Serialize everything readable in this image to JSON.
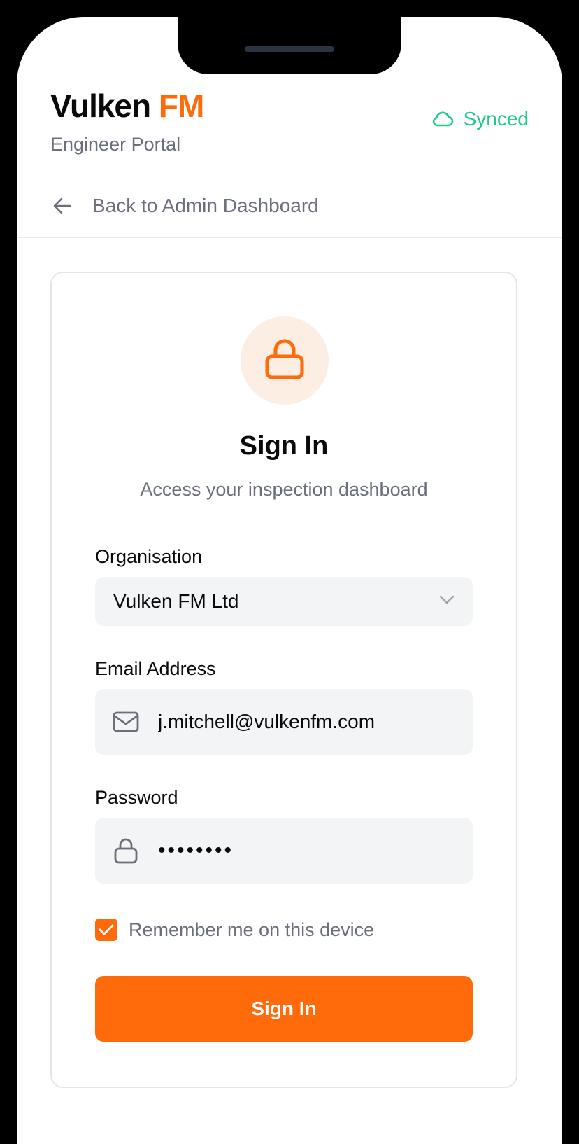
{
  "theme": {
    "accent": "#ff6b0a",
    "success": "#1ec98a"
  },
  "header": {
    "brand_primary": "Vulken",
    "brand_accent": "FM",
    "portal_label": "Engineer Portal",
    "sync_status": "Synced",
    "sync_icon": "cloud-icon",
    "back_label": "Back to Admin Dashboard",
    "back_icon": "arrow-left-icon"
  },
  "signin": {
    "badge_icon": "lock-icon",
    "title": "Sign In",
    "subtitle": "Access your inspection dashboard",
    "organisation": {
      "label": "Organisation",
      "selected": "Vulken FM Ltd",
      "icon": "chevron-down-icon"
    },
    "email": {
      "label": "Email Address",
      "value": "j.mitchell@vulkenfm.com",
      "icon": "mail-icon"
    },
    "password": {
      "label": "Password",
      "value": "••••••••",
      "icon": "lock-icon"
    },
    "remember": {
      "label": "Remember me on this device",
      "checked": true
    },
    "submit_label": "Sign In"
  }
}
